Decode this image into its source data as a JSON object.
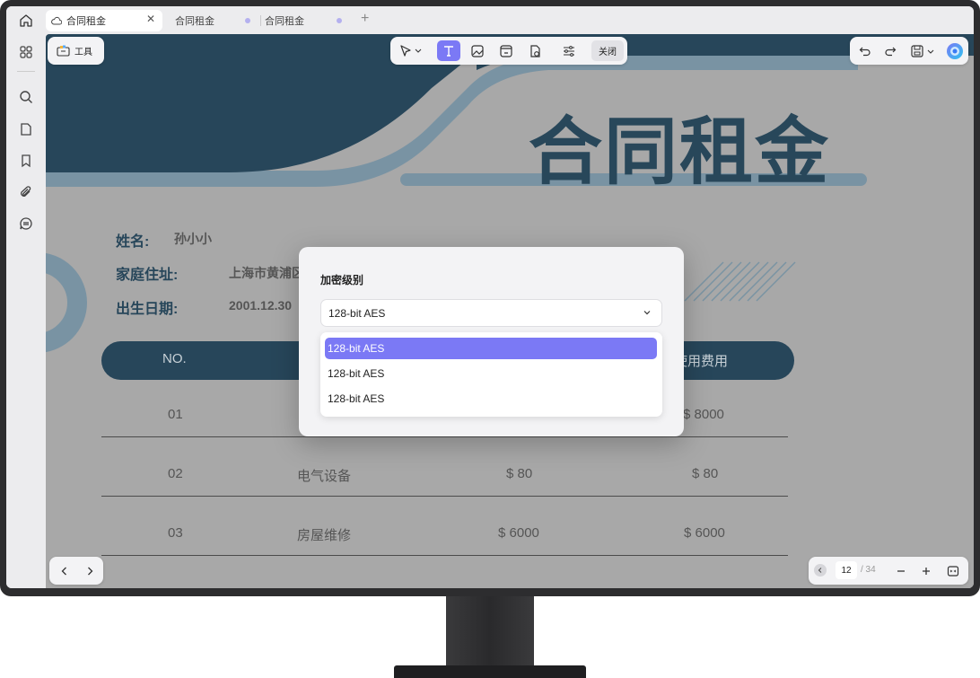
{
  "tabs": [
    {
      "label": "合同租金",
      "active": true
    },
    {
      "label": "合同租金",
      "active": false
    },
    {
      "label": "合同租金",
      "active": false
    }
  ],
  "toolbar": {
    "tools_label": "工具",
    "close_label": "关闭"
  },
  "document": {
    "title": "合同租金",
    "fields": [
      {
        "label": "姓名:",
        "value": "孙小小"
      },
      {
        "label": "家庭住址:",
        "value": "上海市黄浦区"
      },
      {
        "label": "出生日期:",
        "value": "2001.12.30"
      }
    ],
    "table": {
      "headers": [
        "NO.",
        "使用费用"
      ],
      "rows": [
        {
          "no": "01",
          "item": "",
          "price": "",
          "total": "$ 8000"
        },
        {
          "no": "02",
          "item": "电气设备",
          "price": "$ 80",
          "total": "$ 80"
        },
        {
          "no": "03",
          "item": "房屋维修",
          "price": "$ 6000",
          "total": "$ 6000"
        }
      ]
    }
  },
  "modal": {
    "title": "加密级别",
    "selected_value": "128-bit AES",
    "options": [
      "128-bit AES",
      "128-bit AES",
      "128-bit AES"
    ]
  },
  "pagination": {
    "current_page": "12",
    "total_pages": "/ 34"
  },
  "colors": {
    "accent": "#7b79f5",
    "doc_navy": "#28475a"
  }
}
